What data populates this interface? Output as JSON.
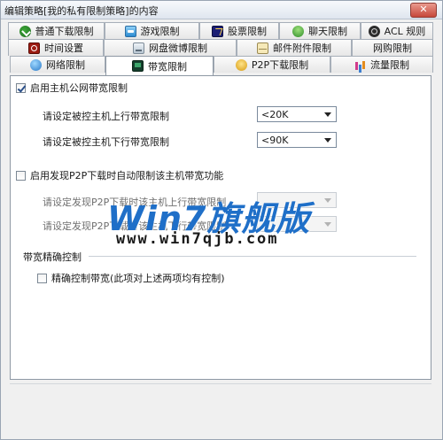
{
  "window": {
    "title": "编辑策略[我的私有限制策略]的内容",
    "close_label": "✕"
  },
  "tabs": {
    "row1": [
      "普通下载限制",
      "游戏限制",
      "股票限制",
      "聊天限制",
      "ACL 规则"
    ],
    "row2": [
      "时间设置",
      "网盘微博限制",
      "邮件附件限制",
      "网购限制"
    ],
    "row3": [
      "网络限制",
      "带宽限制",
      "P2P下载限制",
      "流量限制"
    ],
    "active": "带宽限制",
    "icons": {
      "row1": [
        "download-icon",
        "game-icon",
        "stock-icon",
        "chat-icon",
        "acl-icon"
      ],
      "row2": [
        "clock-icon",
        "cloud-disk-icon",
        "mail-attachment-icon",
        ""
      ],
      "row3": [
        "globe-icon",
        "monitor-icon",
        "p2p-icon",
        "flow-icon"
      ]
    }
  },
  "bandwidth": {
    "enable_label": "启用主机公网带宽限制",
    "enable_checked": true,
    "upload_label": "请设定被控主机上行带宽限制",
    "upload_value": "<20K",
    "download_label": "请设定被控主机下行带宽限制",
    "download_value": "<90K"
  },
  "p2p": {
    "enable_label": "启用发现P2P下载时自动限制该主机带宽功能",
    "enable_checked": false,
    "upload_label": "请设定发现P2P下载时该主机上行带宽限制",
    "upload_value": "",
    "download_label": "请设定发现P2P下载时该主机下行带宽限制",
    "download_value": ""
  },
  "precise": {
    "group_label": "带宽精确控制",
    "check_label": "精确控制带宽(此项对上述两项均有控制)",
    "checked": false
  },
  "watermark": {
    "brand": "Win7旗舰版",
    "url": "www.win7qjb.com"
  }
}
